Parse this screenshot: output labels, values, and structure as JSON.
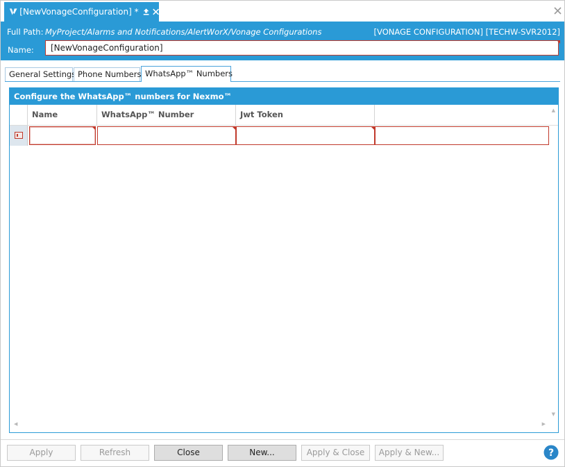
{
  "document_tab": {
    "title": "[NewVonageConfiguration] *",
    "logo_icon": "vonage-logo",
    "pin_icon": "pin-icon",
    "close_icon": "close-icon"
  },
  "window": {
    "close_icon": "close-icon"
  },
  "header": {
    "full_path_label": "Full Path:",
    "full_path_value": "MyProject/Alarms and Notifications/AlertWorX/Vonage Configurations",
    "server_info": "[VONAGE CONFIGURATION] [TECHW-SVR2012]",
    "name_label": "Name:",
    "name_value": "[NewVonageConfiguration]"
  },
  "tabs": [
    {
      "label": "General Settings",
      "active": false
    },
    {
      "label": "Phone Numbers",
      "active": false
    },
    {
      "label": "WhatsApp™ Numbers",
      "active": true
    }
  ],
  "panel": {
    "title": "Configure the WhatsApp™ numbers for Nexmo™",
    "columns": [
      "Name",
      "WhatsApp™ Number",
      "Jwt Token",
      ""
    ],
    "rows": [
      {
        "name": "",
        "whatsapp_number": "",
        "jwt_token": ""
      }
    ]
  },
  "buttons": [
    {
      "label": "Apply",
      "enabled": false
    },
    {
      "label": "Refresh",
      "enabled": false
    },
    {
      "label": "Close",
      "enabled": true
    },
    {
      "label": "New...",
      "enabled": true
    },
    {
      "label": "Apply & Close",
      "enabled": false
    },
    {
      "label": "Apply & New...",
      "enabled": false
    }
  ],
  "colors": {
    "accent": "#2a9ad6",
    "error_border": "#c0392b",
    "help_icon": "#2a86c8"
  },
  "icons": {
    "help": "help-icon",
    "row_edit": "row-edit-icon"
  }
}
